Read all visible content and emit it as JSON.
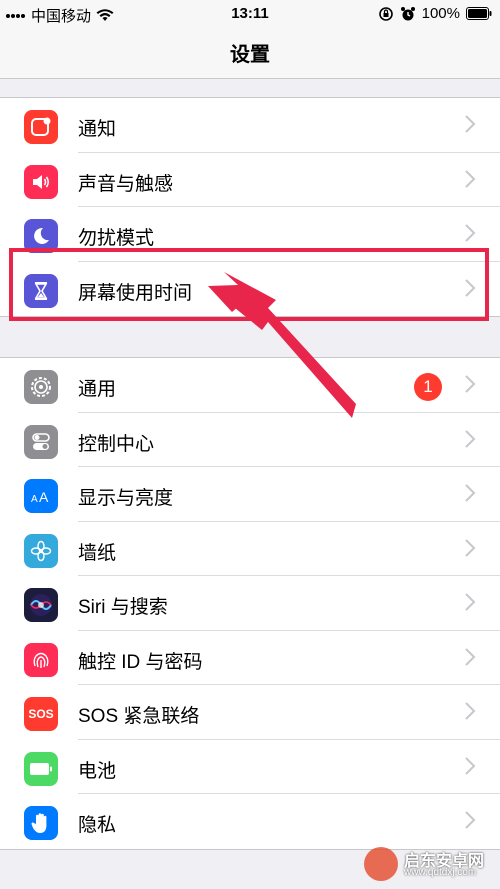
{
  "status_bar": {
    "carrier": "中国移动",
    "time": "13:11",
    "battery": "100%"
  },
  "nav": {
    "title": "设置"
  },
  "groups": [
    {
      "items": [
        {
          "label": "通知",
          "icon": "notifications-icon",
          "color": "#ff3b30"
        },
        {
          "label": "声音与触感",
          "icon": "sounds-icon",
          "color": "#ff2d55"
        },
        {
          "label": "勿扰模式",
          "icon": "moon-icon",
          "color": "#5856d6"
        },
        {
          "label": "屏幕使用时间",
          "icon": "hourglass-icon",
          "color": "#5856d6"
        }
      ]
    },
    {
      "items": [
        {
          "label": "通用",
          "icon": "gear-icon",
          "color": "#8e8e93",
          "badge": "1"
        },
        {
          "label": "控制中心",
          "icon": "toggles-icon",
          "color": "#8e8e93"
        },
        {
          "label": "显示与亮度",
          "icon": "display-icon",
          "color": "#007aff"
        },
        {
          "label": "墙纸",
          "icon": "wallpaper-icon",
          "color": "#34aadc"
        },
        {
          "label": "Siri 与搜索",
          "icon": "siri-icon",
          "color": "#1c1c3c"
        },
        {
          "label": "触控 ID 与密码",
          "icon": "fingerprint-icon",
          "color": "#ff2d55"
        },
        {
          "label": "SOS 紧急联络",
          "icon": "sos-icon",
          "color": "#ff3b30",
          "icon_text": "SOS"
        },
        {
          "label": "电池",
          "icon": "battery-icon",
          "color": "#4cd964"
        },
        {
          "label": "隐私",
          "icon": "hand-icon",
          "color": "#007aff"
        }
      ]
    }
  ],
  "watermark": {
    "name": "启东安卓网",
    "url": "www.qdtdxj.com"
  }
}
